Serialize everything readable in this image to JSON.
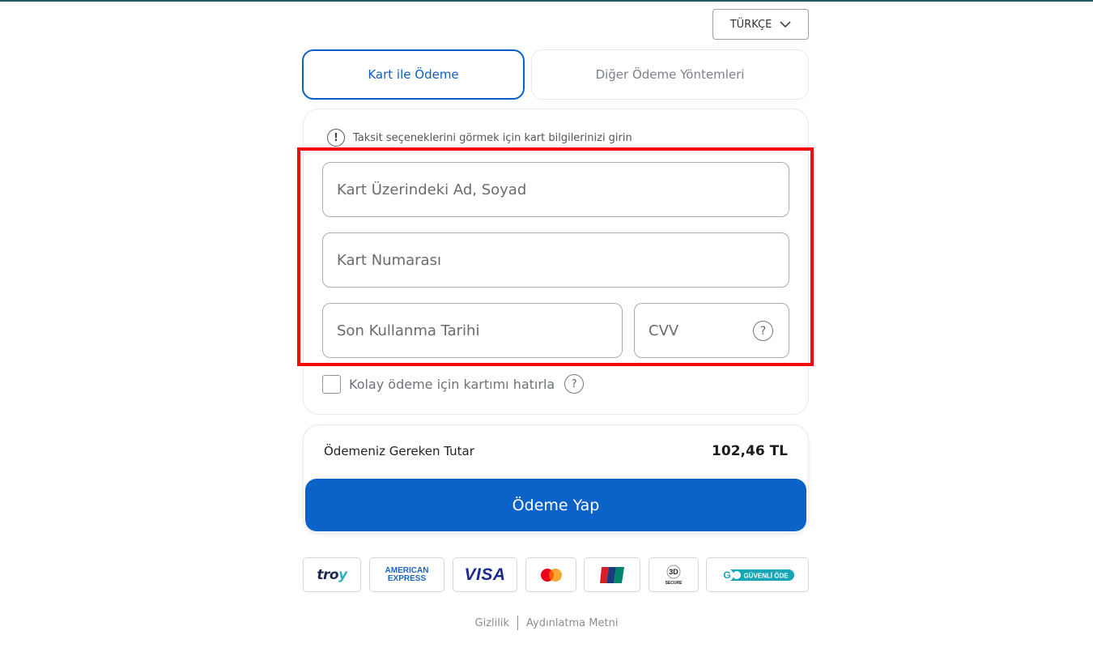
{
  "language": {
    "label": "TÜRKÇE",
    "icon": "chevron-down-icon"
  },
  "tabs": [
    {
      "label": "Kart ile Ödeme",
      "active": true
    },
    {
      "label": "Diğer Ödeme Yöntemleri",
      "active": false
    }
  ],
  "info": {
    "text": "Taksit seçeneklerini görmek için kart bilgilerinizi girin",
    "icon": "info-icon"
  },
  "fields": {
    "card_name": {
      "placeholder": "Kart Üzerindeki Ad, Soyad",
      "value": ""
    },
    "card_number": {
      "placeholder": "Kart Numarası",
      "value": ""
    },
    "expiry": {
      "placeholder": "Son Kullanma Tarihi",
      "value": ""
    },
    "cvv": {
      "placeholder": "CVV",
      "value": ""
    }
  },
  "remember": {
    "label": "Kolay ödeme için kartımı hatırla",
    "checked": false
  },
  "total": {
    "label": "Ödemeniz Gereken Tutar",
    "amount": "102,46 TL"
  },
  "pay_button": {
    "label": "Ödeme Yap"
  },
  "logos": {
    "troy_a": "tro",
    "troy_b": "y",
    "amex_line1": "AMERICAN",
    "amex_line2": "EXPRESS",
    "visa": "VISA",
    "mastercard": "mastercard-logo",
    "unionpay": "unionpay-logo",
    "secure3d_a": "3D",
    "secure3d_b": "SECURE",
    "go_badge": "GÜVENLİ ÖDE"
  },
  "footer": {
    "privacy": "Gizlilik",
    "disclosure": "Aydınlatma Metni"
  },
  "colors": {
    "accent": "#0b62c8",
    "highlight": "#f20b0b",
    "topline": "#1f5d68"
  }
}
